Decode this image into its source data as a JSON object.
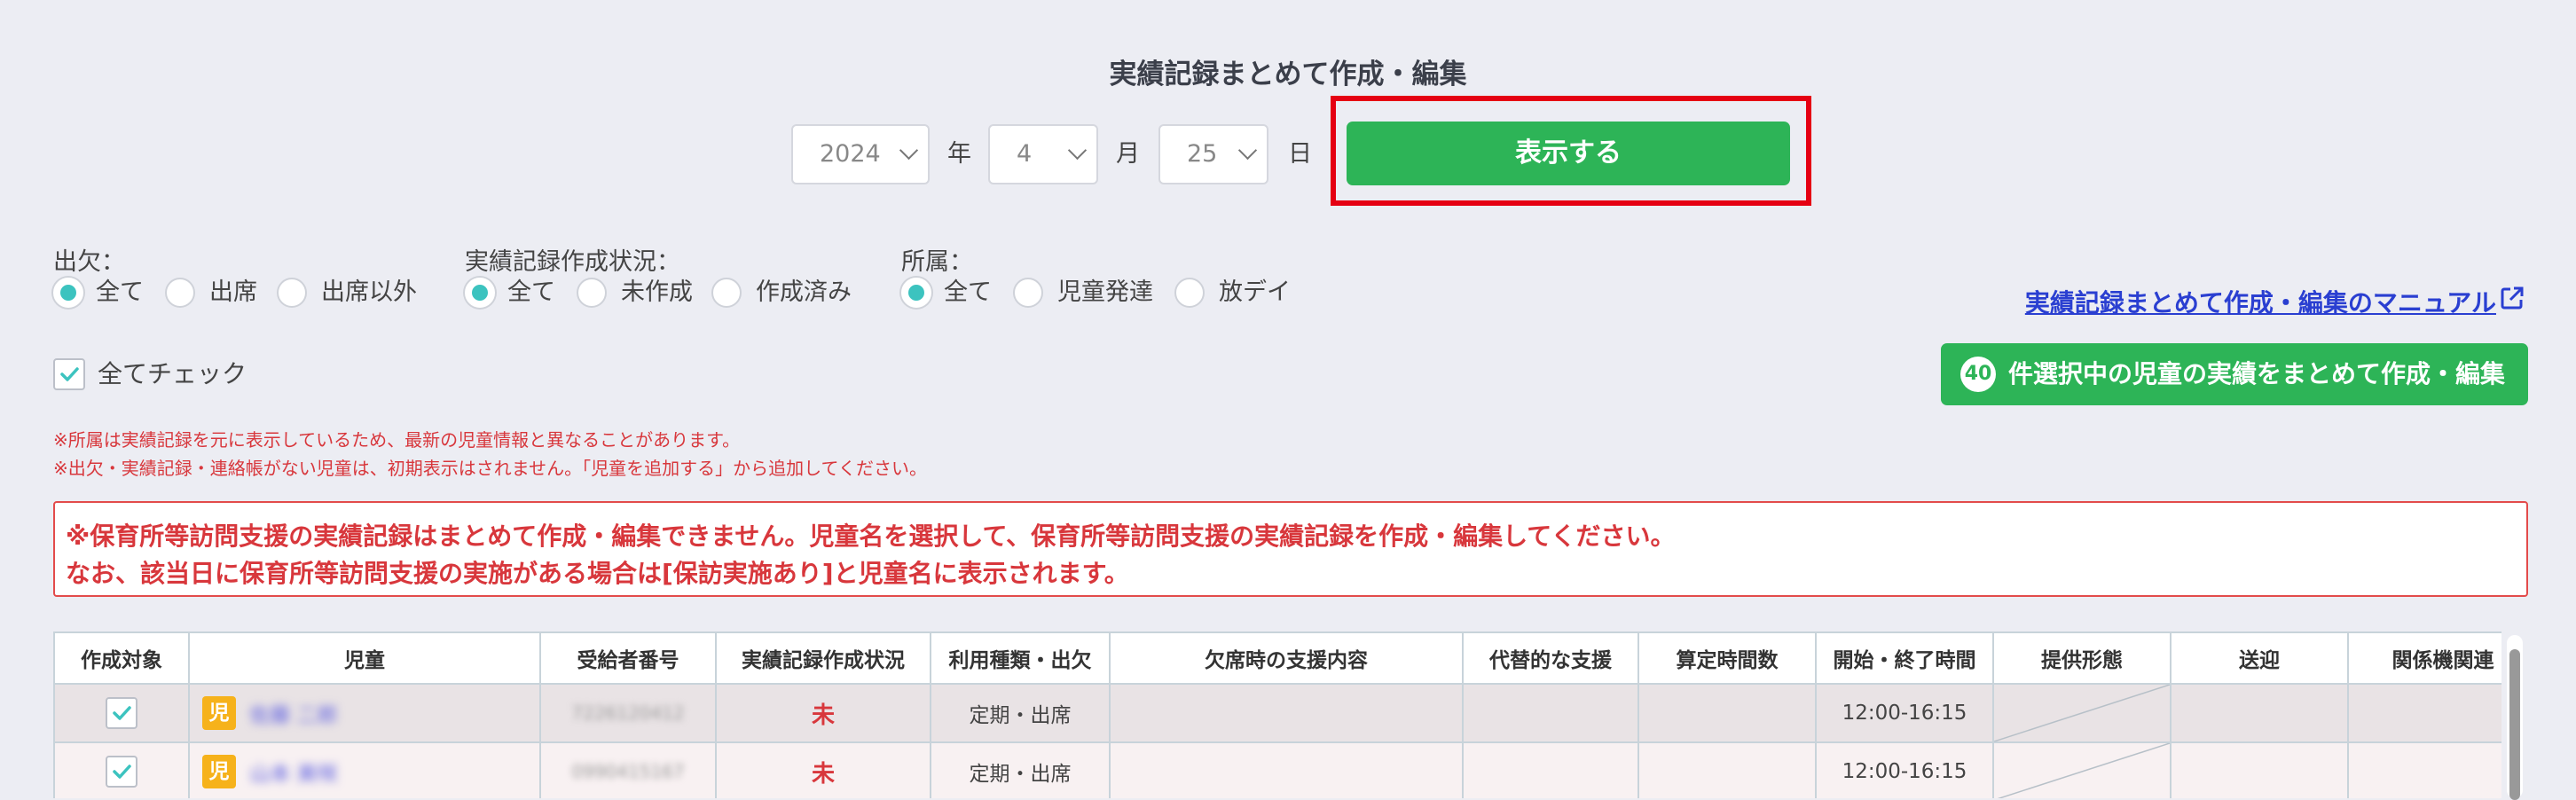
{
  "page": {
    "title": "実績記録まとめて作成・編集"
  },
  "date": {
    "year": "2024",
    "year_unit": "年",
    "month": "4",
    "month_unit": "月",
    "day": "25",
    "day_unit": "日",
    "show_button": "表示する"
  },
  "filters": {
    "attendance": {
      "label": "出欠：",
      "options": [
        "全て",
        "出席",
        "出席以外"
      ],
      "selected": "全て"
    },
    "status": {
      "label": "実績記録作成状況：",
      "options": [
        "全て",
        "未作成",
        "作成済み"
      ],
      "selected": "全て"
    },
    "affiliation": {
      "label": "所属：",
      "options": [
        "全て",
        "児童発達",
        "放デイ"
      ],
      "selected": "全て"
    }
  },
  "manual_link": "実績記録まとめて作成・編集のマニュアル",
  "check_all": "全てチェック",
  "bulk": {
    "count": "40",
    "label": "件選択中の児童の実績をまとめて作成・編集"
  },
  "notes": [
    "※所属は実績記録を元に表示しているため、最新の児童情報と異なることがあります。",
    "※出欠・実績記録・連絡帳がない児童は、初期表示はされません。「児童を追加する」から追加してください。"
  ],
  "alert": [
    "※保育所等訪問支援の実績記録はまとめて作成・編集できません。児童名を選択して、保育所等訪問支援の実績記録を作成・編集してください。",
    "なお、該当日に保育所等訪問支援の実施がある場合は[保訪実施あり]と児童名に表示されます。"
  ],
  "table": {
    "headers": [
      "作成対象",
      "児童",
      "受給者番号",
      "実績記録作成状況",
      "利用種類・出欠",
      "欠席時の支援内容",
      "代替的な支援",
      "算定時間数",
      "開始・終了時間",
      "提供形態",
      "送迎",
      "関係機関連"
    ],
    "rows": [
      {
        "badge": "児",
        "name": "佐藤 二郎",
        "number": "7226120412",
        "status": "未",
        "usage": "定期・出席",
        "time": "12:00-16:15"
      },
      {
        "badge": "児",
        "name": "山本 美咲",
        "number": "0990415167",
        "status": "未",
        "usage": "定期・出席",
        "time": "12:00-16:15"
      }
    ]
  },
  "colors": {
    "accent_green": "#2db457",
    "highlight_red": "#e50012",
    "radio_teal": "#3cc3bf",
    "warning_red": "#d8373c",
    "link_blue": "#2a3fd1"
  }
}
